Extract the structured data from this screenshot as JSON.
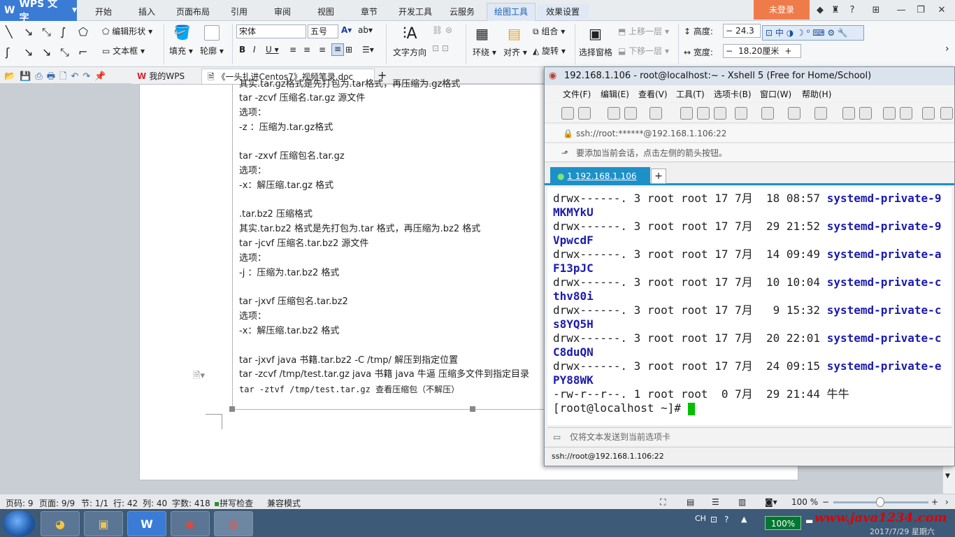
{
  "wps": {
    "app_title": "WPS 文字",
    "tabs": [
      "开始",
      "插入",
      "页面布局",
      "引用",
      "审阅",
      "视图",
      "章节",
      "开发工具",
      "云服务",
      "绘图工具",
      "效果设置"
    ],
    "active_tab": "绘图工具",
    "login_label": "未登录",
    "ribbon": {
      "edit_shape": "编辑形状",
      "text_box": "文本框",
      "fill": "填充",
      "outline": "轮廓",
      "font_name": "宋体",
      "font_size": "五号",
      "text_direction": "文字方向",
      "surround": "环绕",
      "align": "对齐",
      "combine": "组合",
      "rotate": "旋转",
      "select_pane": "选择窗格",
      "bring_forward": "上移一层",
      "send_backward": "下移一层",
      "height_label": "高度:",
      "height_value": "24.3",
      "width_label": "宽度:",
      "width_value": "18.20厘米",
      "ime_text": "中"
    },
    "doc_tabs": [
      {
        "label": "我的WPS"
      },
      {
        "label": "《一头扎进Centos7》视频笔录.doc"
      }
    ]
  },
  "document": {
    "lines": [
      "其实.tar.gz格式是先打包为.tar格式，再压缩为.gz格式",
      "tar -zcvf  压缩名.tar.gz  源文件",
      "选项：",
      "-z ：压缩为.tar.gz格式",
      "",
      "tar -zxvf  压缩包名.tar.gz",
      "选项：",
      "-x：解压缩.tar.gz 格式",
      "",
      ".tar.bz2 压缩格式",
      "其实.tar.bz2 格式是先打包为.tar 格式，再压缩为.bz2 格式",
      "tar -jcvf  压缩名.tar.bz2  源文件",
      "选项：",
      "-j ：压缩为.tar.bz2 格式",
      "",
      "tar -jxvf  压缩包名.tar.bz2",
      "选项：",
      "-x：解压缩.tar.bz2 格式",
      "",
      "tar -jxvf java 书籍.tar.bz2 -C /tmp/  解压到指定位置",
      "tar -zcvf /tmp/test.tar.gz java 书籍  java 牛逼    压缩多文件到指定目录",
      "tar -ztvf /tmp/test.tar.gz  查看压缩包（不解压）"
    ]
  },
  "xshell": {
    "title": "192.168.1.106 - root@localhost:~ - Xshell 5 (Free for Home/School)",
    "menu": [
      "文件(F)",
      "编辑(E)",
      "查看(V)",
      "工具(T)",
      "选项卡(B)",
      "窗口(W)",
      "帮助(H)"
    ],
    "address": "ssh://root:******@192.168.1.106:22",
    "hint": "要添加当前会话，点击左侧的箭头按钮。",
    "tab_label": "1 192.168.1.106",
    "terminal_lines": [
      {
        "text": "drwx------. 3 root root 17 7月  18 08:57 ",
        "name": "systemd-private-9"
      },
      {
        "text": "",
        "name": "MKMYkU"
      },
      {
        "text": "drwx------. 3 root root 17 7月  29 21:52 ",
        "name": "systemd-private-9"
      },
      {
        "text": "",
        "name": "VpwcdF"
      },
      {
        "text": "drwx------. 3 root root 17 7月  14 09:49 ",
        "name": "systemd-private-a"
      },
      {
        "text": "",
        "name": "F13pJC"
      },
      {
        "text": "drwx------. 3 root root 17 7月  10 10:04 ",
        "name": "systemd-private-c"
      },
      {
        "text": "",
        "name": "thv80i"
      },
      {
        "text": "drwx------. 3 root root 17 7月   9 15:32 ",
        "name": "systemd-private-c"
      },
      {
        "text": "",
        "name": "s8YQ5H"
      },
      {
        "text": "drwx------. 3 root root 17 7月  20 22:01 ",
        "name": "systemd-private-c"
      },
      {
        "text": "",
        "name": "C8duQN"
      },
      {
        "text": "drwx------. 3 root root 17 7月  24 09:15 ",
        "name": "systemd-private-e"
      },
      {
        "text": "",
        "name": "PY88WK"
      },
      {
        "text": "-rw-r--r--. 1 root root  0 7月  29 21:44 牛牛",
        "name": ""
      }
    ],
    "prompt": "[root@localhost ~]# ",
    "send_hint": "仅将文本发送到当前选项卡",
    "status": "ssh://root@192.168.1.106:22"
  },
  "statusbar": {
    "page_code": "页码: 9",
    "pages": "页面: 9/9",
    "section": "节: 1/1",
    "row": "行: 42",
    "col": "列: 40",
    "word_count": "字数: 418",
    "spell_check": "拼写检查",
    "compat_mode": "兼容模式",
    "zoom": "100 %"
  },
  "taskbar": {
    "ime": "CH",
    "battery": "100%",
    "watermark": "www.java1234.com",
    "clock": "2017/7/29 星期六"
  },
  "colors": {
    "accent_blue": "#1e90c8",
    "login_orange": "#f07b4a",
    "terminal_name_blue": "#1b1bb0",
    "cursor_green": "#00c000"
  }
}
